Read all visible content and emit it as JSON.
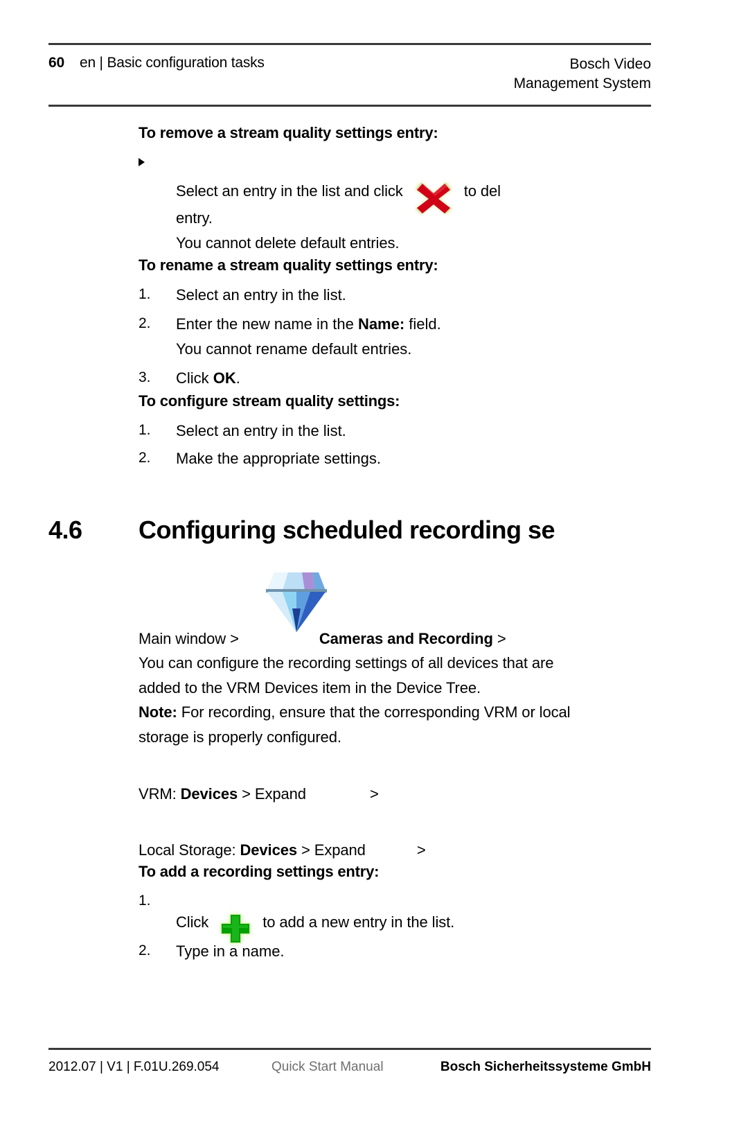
{
  "header": {
    "page_number": "60",
    "breadcrumb": "en | Basic configuration tasks",
    "product_line1": "Bosch Video",
    "product_line2": "Management System"
  },
  "body": {
    "remove_heading": "To remove a stream quality settings entry:",
    "remove_step_before_icon": "Select an entry in the list and click",
    "remove_step_after_icon": "to del",
    "remove_step_line2": "entry.",
    "remove_note": "You cannot delete default entries.",
    "rename_heading": "To rename a stream quality settings entry:",
    "rename_items": [
      {
        "num": "1.",
        "text": "Select an entry in the list."
      },
      {
        "num": "2.",
        "text_before_bold": "Enter the new name in the ",
        "bold": "Name:",
        "text_after_bold": " field.",
        "continuation": "You cannot rename default entries."
      },
      {
        "num": "3.",
        "text_before_bold": "Click ",
        "bold": "OK",
        "text_after_bold": "."
      }
    ],
    "configure_heading": "To configure stream quality settings:",
    "configure_items": [
      {
        "num": "1.",
        "text": "Select an entry in the list."
      },
      {
        "num": "2.",
        "text": "Make the appropriate settings."
      }
    ],
    "section": {
      "number": "4.6",
      "title": "Configuring scheduled recording se"
    },
    "main_window_prefix": "Main window >",
    "main_window_bold": "Cameras and Recording",
    "main_window_suffix": ">",
    "paragraph_line1": "You can configure the recording settings of all devices that are",
    "paragraph_line2": "added to the VRM Devices item in the Device Tree.",
    "note_label": "Note:",
    "note_line1": " For recording, ensure that the corresponding VRM or local",
    "note_line2": "storage is properly configured.",
    "vrm_prefix": "VRM: ",
    "vrm_bold": "Devices",
    "vrm_mid": " > Expand",
    "vrm_suffix": ">",
    "local_prefix": "Local Storage: ",
    "local_bold": "Devices",
    "local_mid": " > Expand",
    "local_suffix": ">",
    "add_heading": "To add a recording settings entry:",
    "add_step1_num": "1.",
    "add_step1_before_icon": "Click",
    "add_step1_after_icon": "to add a new entry in the list.",
    "add_step2_num": "2.",
    "add_step2_text": "Type in a name."
  },
  "icons": {
    "delete": "red-x-delete-icon",
    "add": "green-plus-add-icon",
    "gem": "blue-diamond-icon",
    "bullet": "triangle-bullet-icon"
  },
  "colors": {
    "delete_red": "#d00017",
    "add_green": "#00a000",
    "glow": "#d8f5a8",
    "gem_blue": "#5b9bd5",
    "gem_light": "#dff0fb",
    "gem_purple": "#a98fd6",
    "rule": "#3a3a3a",
    "footer_gray": "#6f6f6f"
  },
  "footer": {
    "left": "2012.07 | V1 | F.01U.269.054",
    "middle": "Quick Start Manual",
    "right": "Bosch Sicherheitssysteme GmbH"
  }
}
